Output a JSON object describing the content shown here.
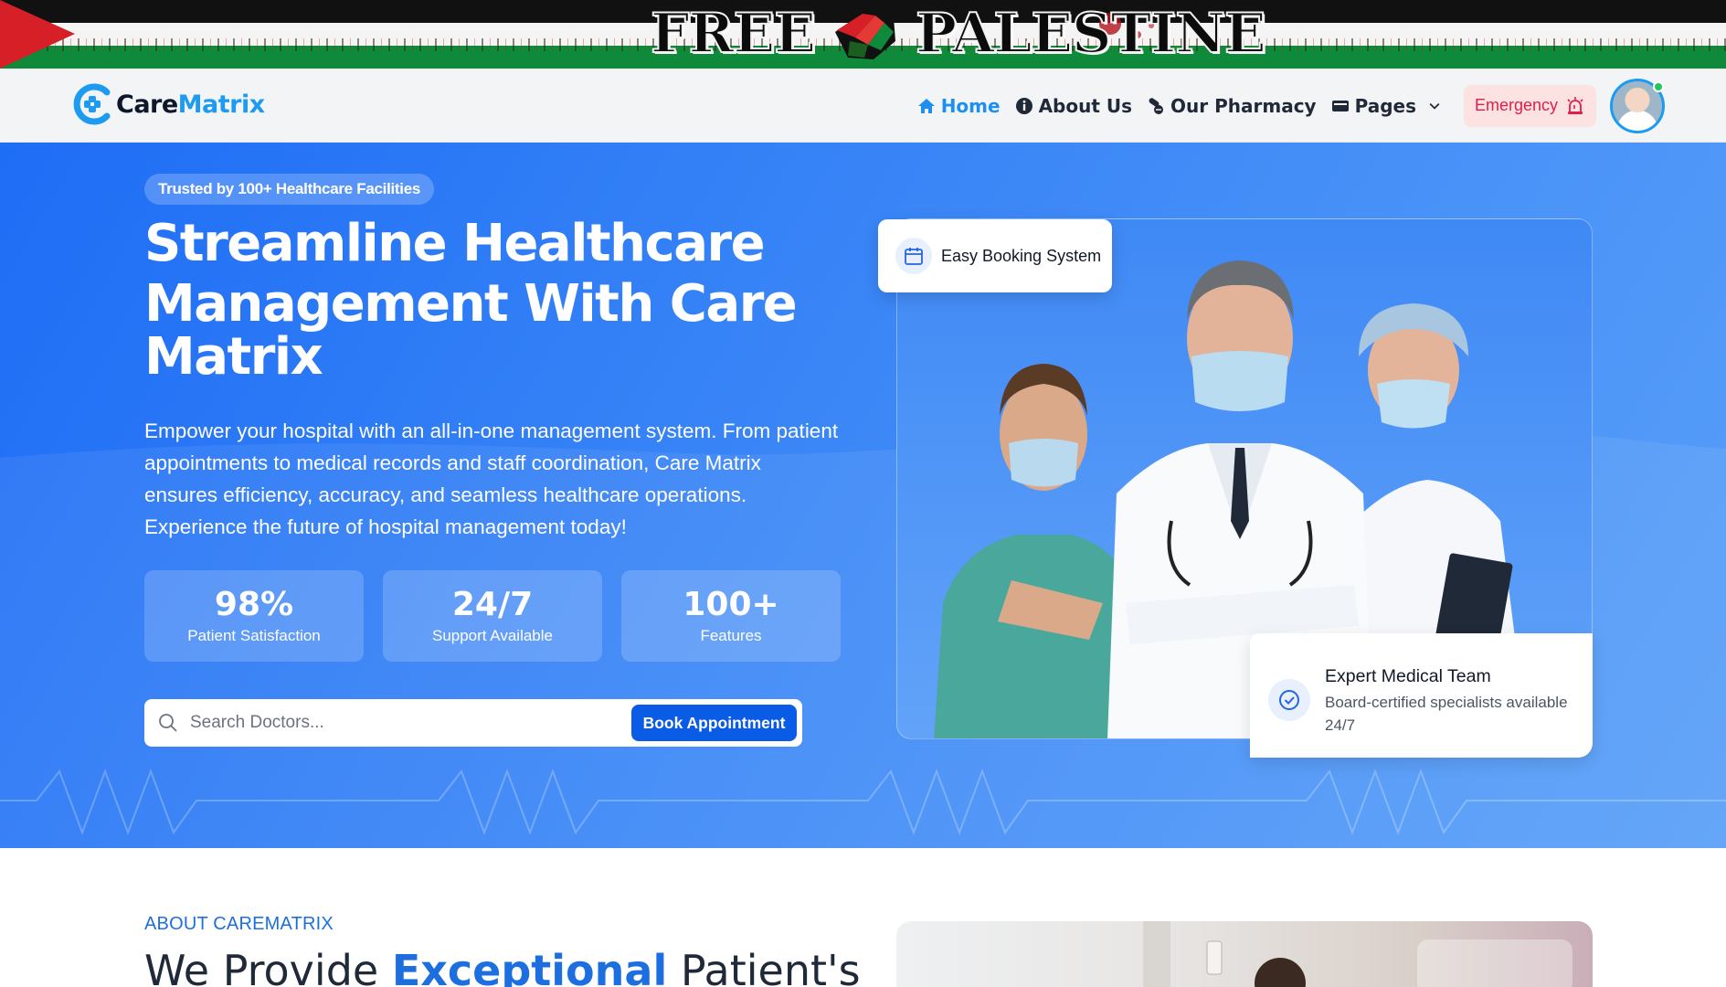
{
  "banner": {
    "word_left": "FREE",
    "word_right": "PALESTINE"
  },
  "header": {
    "logo": {
      "care": "Care",
      "matrix": "Matrix"
    },
    "nav": [
      {
        "label": "Home",
        "icon": "home-icon",
        "active": true
      },
      {
        "label": "About Us",
        "icon": "info-icon",
        "active": false
      },
      {
        "label": "Our Pharmacy",
        "icon": "pills-icon",
        "active": false
      },
      {
        "label": "Pages",
        "icon": "pages-icon",
        "active": false
      }
    ],
    "emergency_label": "Emergency"
  },
  "hero": {
    "badge": "Trusted by 100+ Healthcare Facilities",
    "title_line1": "Streamline Healthcare",
    "title_line2": "Management With Care",
    "title_line3": "Matrix",
    "description": "Empower your hospital with an all-in-one management system. From patient appointments to medical records and staff coordination, Care Matrix ensures efficiency, accuracy, and seamless healthcare operations. Experience the future of hospital management today!",
    "stats": [
      {
        "value": "98%",
        "label": "Patient Satisfaction"
      },
      {
        "value": "24/7",
        "label": "Support Available"
      },
      {
        "value": "100+",
        "label": "Features"
      }
    ],
    "search": {
      "placeholder": "Search Doctors...",
      "button": "Book Appointment"
    },
    "booking_card": "Easy Booking System",
    "team_card": {
      "title": "Expert Medical Team",
      "subtitle": "Board-certified specialists available 24/7"
    }
  },
  "about": {
    "label": "ABOUT CAREMATRIX",
    "title_pre": "We Provide ",
    "title_accent": "Exceptional",
    "title_post": " Patient's"
  },
  "colors": {
    "primary": "#1d6fe0",
    "brand_blue": "#1d9bf0",
    "emergency": "#e11d48",
    "hero_start": "#1e6df5",
    "hero_end": "#5aa0f8"
  }
}
